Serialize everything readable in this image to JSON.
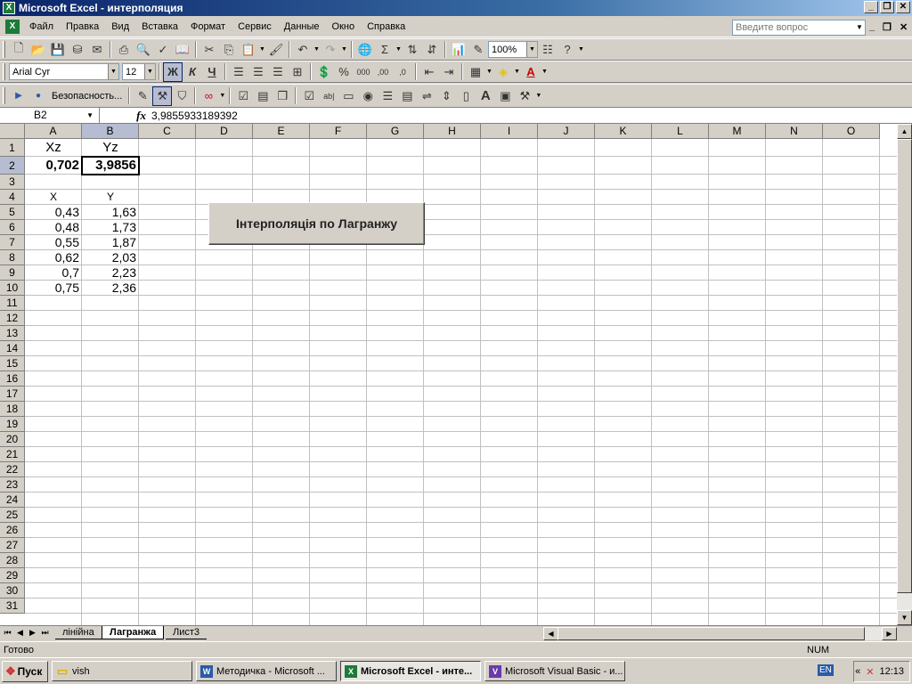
{
  "window": {
    "title": "Microsoft Excel - интерполяция"
  },
  "menu": {
    "items": [
      "Файл",
      "Правка",
      "Вид",
      "Вставка",
      "Формат",
      "Сервис",
      "Данные",
      "Окно",
      "Справка"
    ],
    "question_placeholder": "Введите вопрос"
  },
  "toolbar": {
    "zoom": "100%",
    "font": "Arial Cyr",
    "size": "12",
    "bold": "Ж",
    "italic": "К",
    "underline": "Ч",
    "security": "Безопасность..."
  },
  "formula_bar": {
    "name_box": "B2",
    "fx": "fx",
    "value": "3,9855933189392"
  },
  "grid": {
    "columns": [
      "A",
      "B",
      "C",
      "D",
      "E",
      "F",
      "G",
      "H",
      "I",
      "J",
      "K",
      "L",
      "M",
      "N",
      "O"
    ],
    "rows": [
      "1",
      "2",
      "3",
      "4",
      "5",
      "6",
      "7",
      "8",
      "9",
      "10",
      "11",
      "12",
      "13",
      "14",
      "15",
      "16",
      "17",
      "18",
      "19",
      "20",
      "21",
      "22",
      "23",
      "24",
      "25",
      "26",
      "27",
      "28",
      "29",
      "30",
      "31"
    ],
    "cells": {
      "A1": "Xz",
      "B1": "Yz",
      "A2": "0,702",
      "B2": "3,9856",
      "A4": "X",
      "B4": "Y",
      "A5": "0,43",
      "B5": "1,63",
      "A6": "0,48",
      "B6": "1,73",
      "A7": "0,55",
      "B7": "1,87",
      "A8": "0,62",
      "B8": "2,03",
      "A9": "0,7",
      "B9": "2,23",
      "A10": "0,75",
      "B10": "2,36"
    }
  },
  "macro_button": {
    "label": "Інтерполяція  по Лагранжу"
  },
  "sheets": {
    "tabs": [
      "лінійна",
      "Лагранжа",
      "Лист3"
    ],
    "active": "Лагранжа"
  },
  "status": {
    "ready": "Готово",
    "num": "NUM"
  },
  "taskbar": {
    "start": "Пуск",
    "items": [
      "vish",
      "Методичка - Microsoft ...",
      "Microsoft Excel - инте...",
      "Microsoft Visual Basic - и..."
    ],
    "lang": "EN",
    "clock": "12:13"
  }
}
